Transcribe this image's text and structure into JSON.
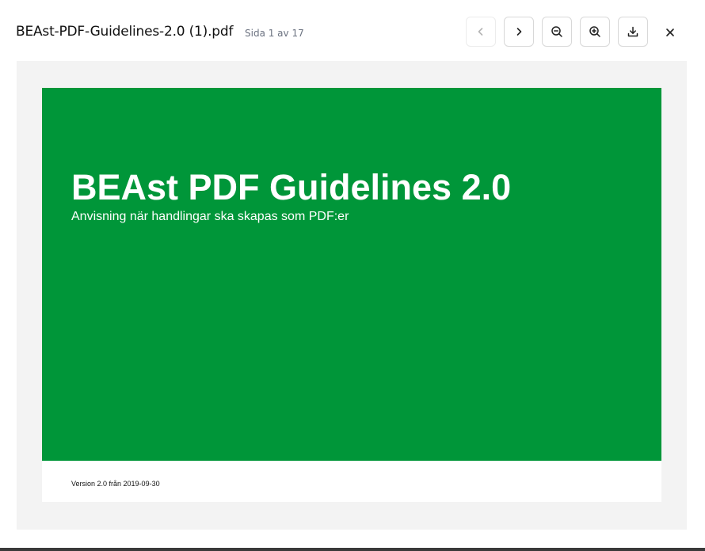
{
  "header": {
    "file_name": "BEAst-PDF-Guidelines-2.0 (1).pdf",
    "page_info": "Sida 1 av 17"
  },
  "toolbar": {
    "buttons": [
      {
        "icon": "chevron-left-icon",
        "enabled": false
      },
      {
        "icon": "chevron-right-icon",
        "enabled": true
      },
      {
        "icon": "zoom-out-icon",
        "enabled": true
      },
      {
        "icon": "zoom-in-icon",
        "enabled": true
      },
      {
        "icon": "download-icon",
        "enabled": true
      }
    ],
    "close_icon": "close-icon"
  },
  "document": {
    "title": "BEAst PDF Guidelines 2.0",
    "subtitle": "Anvisning när handlingar ska skapas som PDF:er",
    "version_line": "Version 2.0 från 2019-09-30",
    "cover_color": "#009639"
  },
  "colors": {
    "viewer_background": "#f3f3f3",
    "muted_text": "#6b7280"
  }
}
